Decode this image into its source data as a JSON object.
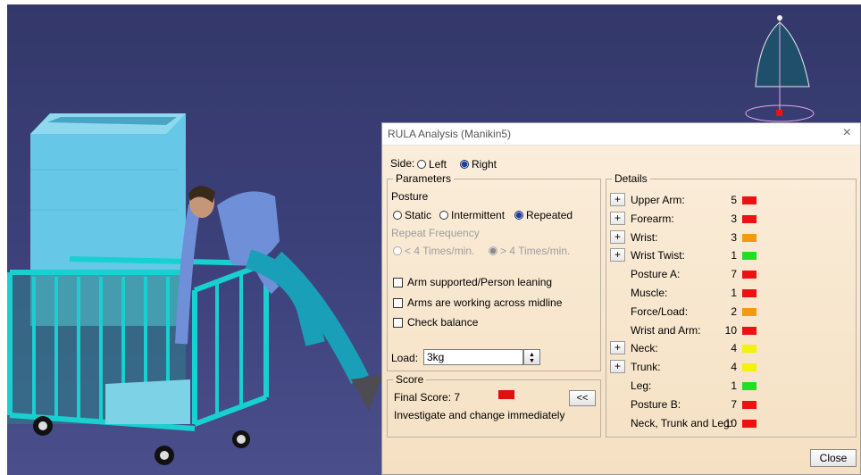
{
  "dialog": {
    "title": "RULA Analysis (Manikin5)",
    "side": {
      "label": "Side:",
      "left": "Left",
      "right": "Right",
      "selected": "Right"
    },
    "parameters": {
      "legend": "Parameters",
      "posture_label": "Posture",
      "posture_options": [
        "Static",
        "Intermittent",
        "Repeated"
      ],
      "posture_selected": "Repeated",
      "repeat_label": "Repeat Frequency",
      "repeat_options": [
        "< 4 Times/min.",
        "> 4 Times/min."
      ],
      "repeat_selected": "> 4 Times/min.",
      "checkboxes": [
        "Arm supported/Person leaning",
        "Arms are working across midline",
        "Check balance"
      ],
      "load_label": "Load:",
      "load_value": "3kg"
    },
    "score": {
      "legend": "Score",
      "final_label": "Final Score: 7",
      "final_color": "#e01010",
      "message": "Investigate and change immediately",
      "back_label": "<<"
    },
    "details": {
      "legend": "Details",
      "expand_label": "+",
      "rows": [
        {
          "label": "Upper Arm:",
          "value": "5",
          "color": "#ee1111",
          "expandable": true
        },
        {
          "label": "Forearm:",
          "value": "3",
          "color": "#ee1111",
          "expandable": true
        },
        {
          "label": "Wrist:",
          "value": "3",
          "color": "#f39a10",
          "expandable": true
        },
        {
          "label": "Wrist Twist:",
          "value": "1",
          "color": "#22dd22",
          "expandable": true
        },
        {
          "label": "Posture A:",
          "value": "7",
          "color": "#ee1111",
          "expandable": false
        },
        {
          "label": "Muscle:",
          "value": "1",
          "color": "#ee1111",
          "expandable": false
        },
        {
          "label": "Force/Load:",
          "value": "2",
          "color": "#f39a10",
          "expandable": false
        },
        {
          "label": "Wrist and Arm:",
          "value": "10",
          "color": "#ee1111",
          "expandable": false
        },
        {
          "label": "Neck:",
          "value": "4",
          "color": "#f2f20a",
          "expandable": true
        },
        {
          "label": "Trunk:",
          "value": "4",
          "color": "#f2f20a",
          "expandable": true
        },
        {
          "label": "Leg:",
          "value": "1",
          "color": "#22dd22",
          "expandable": false
        },
        {
          "label": "Posture B:",
          "value": "7",
          "color": "#ee1111",
          "expandable": false
        },
        {
          "label": "Neck, Trunk and Leg:",
          "value": "10",
          "color": "#ee1111",
          "expandable": false
        }
      ]
    },
    "close_label": "Close",
    "close_x": "×"
  },
  "scene": {
    "background_color": "#373b73",
    "objects": [
      "manikin",
      "cart",
      "container",
      "compass-icon"
    ]
  }
}
